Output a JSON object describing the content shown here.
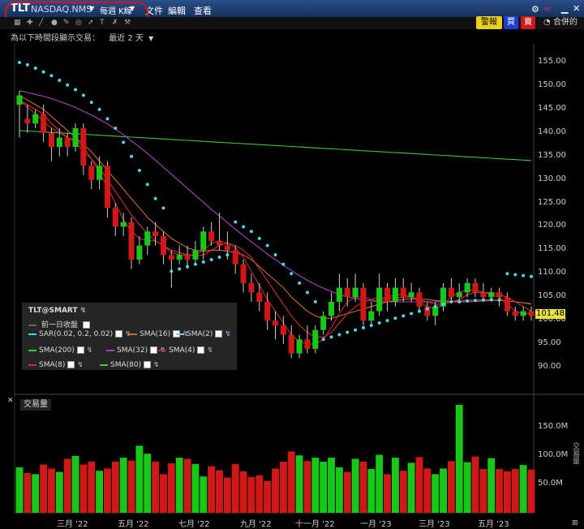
{
  "titlebar": {
    "symbol": "TLT",
    "exchange": "NASDAQ.NMS",
    "period": "每週 K線",
    "menu": [
      "文件",
      "編輯",
      "查看"
    ],
    "alert_label": "警報",
    "buy_label": "買",
    "sell_label": "賣",
    "merged_label": "合併的"
  },
  "period_bar": {
    "prefix": "為以下時間段顯示交易：",
    "range": "最近 2 天"
  },
  "legend": {
    "contract": "TLT@SMART",
    "prev_close": "前一日收盤",
    "items": [
      {
        "label": "SAR(0.02, 0.2, 0.02)",
        "color": "#4fd6e6"
      },
      {
        "label": "SMA(16)",
        "color": "#d06a2a"
      },
      {
        "label": "SMA(2)",
        "color": "#8ed0e8"
      },
      {
        "label": "SMA(200)",
        "color": "#3cc63c"
      },
      {
        "label": "SMA(32)",
        "color": "#b040c0"
      },
      {
        "label": "SMA(4)",
        "color": "#c03030"
      },
      {
        "label": "SMA(8)",
        "color": "#d03030"
      },
      {
        "label": "SMA(80)",
        "color": "#46c24a"
      }
    ]
  },
  "price_axis": [
    "155.00",
    "150.00",
    "145.00",
    "140.00",
    "135.00",
    "130.00",
    "125.00",
    "120.00",
    "115.00",
    "110.00",
    "105.00",
    "100.00",
    "95.00",
    "90.00"
  ],
  "last_price": "101.48",
  "volume_panel": {
    "title": "交易量",
    "axis": [
      "150.0M",
      "100.0M",
      "50.0M"
    ],
    "side_label": "交易量"
  },
  "x_axis": [
    "三月 '22",
    "五月 '22",
    "七月 '22",
    "九月 '22",
    "十一月 '22",
    "一月 '23",
    "三月 '23",
    "五月 '23"
  ],
  "colors": {
    "up": "#18c818",
    "down": "#d01818",
    "sar": "#4fd6e6",
    "accent": "#e8e33a"
  },
  "chart_data": {
    "type": "candlestick",
    "price_range": [
      87,
      158
    ],
    "volume_range": [
      0,
      200
    ],
    "candles": [
      {
        "o": 146,
        "c": 148,
        "h": 149,
        "l": 139
      },
      {
        "o": 143,
        "c": 142,
        "h": 146,
        "l": 140
      },
      {
        "o": 142,
        "c": 144,
        "h": 145,
        "l": 141
      },
      {
        "o": 144,
        "c": 140,
        "h": 146,
        "l": 138
      },
      {
        "o": 140,
        "c": 137,
        "h": 141,
        "l": 134
      },
      {
        "o": 137,
        "c": 139,
        "h": 141,
        "l": 135
      },
      {
        "o": 139,
        "c": 137,
        "h": 140,
        "l": 135
      },
      {
        "o": 137,
        "c": 141,
        "h": 142,
        "l": 136
      },
      {
        "o": 141,
        "c": 133,
        "h": 142,
        "l": 131
      },
      {
        "o": 133,
        "c": 130,
        "h": 134,
        "l": 128
      },
      {
        "o": 130,
        "c": 133,
        "h": 135,
        "l": 128
      },
      {
        "o": 133,
        "c": 124,
        "h": 134,
        "l": 122
      },
      {
        "o": 124,
        "c": 120,
        "h": 125,
        "l": 118
      },
      {
        "o": 120,
        "c": 121,
        "h": 123,
        "l": 118
      },
      {
        "o": 121,
        "c": 113,
        "h": 122,
        "l": 111
      },
      {
        "o": 113,
        "c": 116,
        "h": 118,
        "l": 112
      },
      {
        "o": 116,
        "c": 119,
        "h": 120,
        "l": 114
      },
      {
        "o": 119,
        "c": 118,
        "h": 121,
        "l": 116
      },
      {
        "o": 118,
        "c": 114,
        "h": 119,
        "l": 112
      },
      {
        "o": 114,
        "c": 113,
        "h": 115,
        "l": 107
      },
      {
        "o": 113,
        "c": 114,
        "h": 116,
        "l": 112
      },
      {
        "o": 114,
        "c": 113,
        "h": 116,
        "l": 111
      },
      {
        "o": 113,
        "c": 115,
        "h": 117,
        "l": 112
      },
      {
        "o": 115,
        "c": 119,
        "h": 120,
        "l": 113
      },
      {
        "o": 119,
        "c": 117,
        "h": 121,
        "l": 116
      },
      {
        "o": 117,
        "c": 116,
        "h": 123,
        "l": 115
      },
      {
        "o": 116,
        "c": 115,
        "h": 119,
        "l": 113
      },
      {
        "o": 115,
        "c": 112,
        "h": 116,
        "l": 110
      },
      {
        "o": 112,
        "c": 108,
        "h": 113,
        "l": 106
      },
      {
        "o": 108,
        "c": 106,
        "h": 110,
        "l": 104
      },
      {
        "o": 106,
        "c": 104,
        "h": 108,
        "l": 102
      },
      {
        "o": 104,
        "c": 100,
        "h": 106,
        "l": 98
      },
      {
        "o": 100,
        "c": 99,
        "h": 102,
        "l": 96
      },
      {
        "o": 99,
        "c": 97,
        "h": 101,
        "l": 95
      },
      {
        "o": 97,
        "c": 93,
        "h": 99,
        "l": 92
      },
      {
        "o": 93,
        "c": 96,
        "h": 97,
        "l": 92
      },
      {
        "o": 96,
        "c": 94,
        "h": 99,
        "l": 93
      },
      {
        "o": 94,
        "c": 98,
        "h": 99,
        "l": 93
      },
      {
        "o": 98,
        "c": 101,
        "h": 102,
        "l": 97
      },
      {
        "o": 101,
        "c": 104,
        "h": 106,
        "l": 100
      },
      {
        "o": 104,
        "c": 107,
        "h": 110,
        "l": 102
      },
      {
        "o": 107,
        "c": 105,
        "h": 109,
        "l": 103
      },
      {
        "o": 105,
        "c": 107,
        "h": 110,
        "l": 104
      },
      {
        "o": 107,
        "c": 100,
        "h": 108,
        "l": 99
      },
      {
        "o": 100,
        "c": 102,
        "h": 104,
        "l": 99
      },
      {
        "o": 102,
        "c": 107,
        "h": 110,
        "l": 101
      },
      {
        "o": 107,
        "c": 104,
        "h": 108,
        "l": 102
      },
      {
        "o": 104,
        "c": 107,
        "h": 109,
        "l": 103
      },
      {
        "o": 107,
        "c": 105,
        "h": 109,
        "l": 104
      },
      {
        "o": 105,
        "c": 106,
        "h": 108,
        "l": 104
      },
      {
        "o": 106,
        "c": 103,
        "h": 107,
        "l": 102
      },
      {
        "o": 103,
        "c": 101,
        "h": 104,
        "l": 100
      },
      {
        "o": 101,
        "c": 103,
        "h": 104,
        "l": 99
      },
      {
        "o": 103,
        "c": 107,
        "h": 108,
        "l": 102
      },
      {
        "o": 107,
        "c": 105,
        "h": 109,
        "l": 104
      },
      {
        "o": 105,
        "c": 106,
        "h": 108,
        "l": 104
      },
      {
        "o": 106,
        "c": 108,
        "h": 109,
        "l": 105
      },
      {
        "o": 108,
        "c": 106,
        "h": 109,
        "l": 105
      },
      {
        "o": 106,
        "c": 105,
        "h": 108,
        "l": 104
      },
      {
        "o": 105,
        "c": 106,
        "h": 107,
        "l": 104
      },
      {
        "o": 106,
        "c": 105,
        "h": 107,
        "l": 103
      },
      {
        "o": 105,
        "c": 102,
        "h": 106,
        "l": 101
      },
      {
        "o": 102,
        "c": 101,
        "h": 103,
        "l": 100
      },
      {
        "o": 101,
        "c": 102,
        "h": 103,
        "l": 100
      },
      {
        "o": 102,
        "c": 101,
        "h": 103,
        "l": 100
      }
    ],
    "volume": [
      80,
      70,
      68,
      85,
      78,
      72,
      95,
      100,
      85,
      90,
      74,
      78,
      90,
      97,
      92,
      118,
      104,
      90,
      68,
      87,
      97,
      95,
      86,
      64,
      82,
      75,
      62,
      86,
      73,
      63,
      66,
      56,
      78,
      90,
      108,
      101,
      91,
      97,
      90,
      97,
      80,
      72,
      95,
      90,
      77,
      102,
      68,
      97,
      74,
      88,
      98,
      78,
      68,
      78,
      91,
      190,
      89,
      99,
      77,
      96,
      77,
      73,
      77,
      84,
      76
    ],
    "sma200": [
      140.5,
      140.4,
      140.3,
      140.2,
      140.1,
      140.0,
      139.9,
      139.8,
      139.7,
      139.6,
      139.5,
      139.4,
      139.3,
      139.2,
      139.1,
      139.0,
      138.9,
      138.8,
      138.7,
      138.6,
      138.5,
      138.4,
      138.3,
      138.2,
      138.1,
      138.0,
      137.9,
      137.8,
      137.7,
      137.6,
      137.5,
      137.4,
      137.3,
      137.2,
      137.1,
      137.0,
      136.9,
      136.8,
      136.7,
      136.6,
      136.5,
      136.4,
      136.3,
      136.2,
      136.1,
      136.0,
      135.9,
      135.8,
      135.7,
      135.6,
      135.5,
      135.4,
      135.3,
      135.2,
      135.1,
      135.0,
      134.9,
      134.8,
      134.7,
      134.6,
      134.5,
      134.4,
      134.3,
      134.2,
      134.1
    ],
    "sma32": [
      149,
      148.6,
      148.2,
      147.8,
      147.3,
      146.7,
      146.1,
      145.4,
      144.6,
      143.8,
      142.9,
      141.9,
      140.8,
      139.6,
      138.3,
      137.0,
      135.6,
      134.2,
      132.7,
      131.2,
      129.7,
      128.2,
      126.7,
      125.2,
      123.7,
      122.3,
      120.9,
      119.5,
      118.1,
      116.8,
      115.5,
      114.2,
      113.0,
      111.8,
      110.7,
      109.6,
      108.6,
      107.7,
      106.9,
      106.2,
      105.6,
      105.1,
      104.7,
      104.4,
      104.2,
      104.1,
      104.0,
      104.0,
      104.0,
      104.0,
      104.0,
      104.0,
      104.0,
      104.0,
      104.1,
      104.2,
      104.3,
      104.4,
      104.4,
      104.4,
      104.3,
      104.2,
      104.0,
      103.8,
      103.6
    ],
    "sma16": [
      148,
      147,
      146,
      145,
      143.5,
      142,
      140.5,
      139,
      137.5,
      136,
      134,
      132,
      130,
      128,
      126,
      124,
      122,
      120.5,
      119,
      117.5,
      116.5,
      115.5,
      115,
      114.8,
      115,
      115,
      114.8,
      114.5,
      114,
      113,
      111.5,
      110,
      108.5,
      107,
      105,
      103.5,
      102,
      101,
      100.5,
      100.5,
      101,
      101.5,
      102,
      102.5,
      103,
      103.5,
      104,
      104.3,
      104.5,
      104.6,
      104.6,
      104.5,
      104.3,
      104.1,
      104.0,
      104.0,
      104.0,
      104.1,
      104.2,
      104.3,
      104.3,
      104.2,
      104.0,
      103.8,
      103.5
    ],
    "sma8": [
      147,
      146,
      145,
      144,
      142,
      140.5,
      139,
      138,
      136,
      134.5,
      132.5,
      130,
      127.5,
      125,
      122.5,
      120.5,
      118.5,
      117,
      116,
      115,
      114.5,
      114,
      113.8,
      114,
      115,
      116,
      116.5,
      116,
      115,
      113.5,
      111,
      108.5,
      106,
      103.5,
      101,
      99,
      97.5,
      96.5,
      96.5,
      97.5,
      99.5,
      101.5,
      103,
      104,
      104.5,
      105,
      104.8,
      104.8,
      105,
      105,
      104.5,
      104,
      103.5,
      103.5,
      104,
      104.5,
      105.5,
      106,
      106,
      106,
      105.5,
      105,
      104,
      103,
      102
    ],
    "sma4": [
      147,
      145.5,
      144,
      142.5,
      141,
      140,
      139,
      138.5,
      137,
      134.5,
      131.5,
      128.5,
      125,
      121.5,
      119,
      117.5,
      117,
      117,
      116,
      114.5,
      114,
      114,
      114,
      115,
      116.5,
      117,
      116.5,
      115.5,
      113.5,
      110.5,
      107.5,
      104.5,
      102,
      99.5,
      97,
      95.5,
      95,
      95,
      96,
      98.5,
      101.5,
      104,
      105,
      105,
      104.5,
      104,
      105,
      105.5,
      105.5,
      105,
      104,
      103,
      102.5,
      103.5,
      105,
      106,
      106.5,
      106.5,
      106,
      105.5,
      105,
      103.5,
      102,
      101.5,
      101.5
    ],
    "sar": [
      155,
      154.5,
      153.8,
      153,
      152.2,
      151.2,
      150.2,
      149.2,
      148,
      146.5,
      145,
      143,
      141,
      138,
      135,
      132,
      129,
      126,
      124,
      110.5,
      111,
      111.5,
      112,
      112.5,
      113,
      113.5,
      114,
      121,
      120,
      119,
      117.5,
      116,
      114,
      112,
      110,
      108,
      106,
      104,
      96,
      96.5,
      97,
      97.5,
      98,
      98.5,
      99,
      99.5,
      100,
      100.5,
      101,
      101.5,
      102,
      102.5,
      103,
      103.5,
      104,
      104,
      104.2,
      104.3,
      104.4,
      104.5,
      104.4,
      110,
      109.8,
      109.6,
      109.4
    ]
  }
}
